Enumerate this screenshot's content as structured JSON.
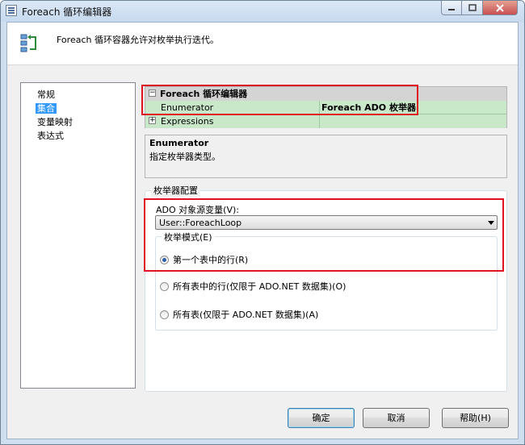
{
  "window": {
    "title": "Foreach 循环编辑器",
    "buttons": [
      "minimize",
      "maximize",
      "close"
    ]
  },
  "header": {
    "description": "Foreach 循环容器允许对枚举执行迭代。",
    "icon": "foreach-container-icon"
  },
  "nav": {
    "items": [
      {
        "label": "常规",
        "selected": false
      },
      {
        "label": "集合",
        "selected": true
      },
      {
        "label": "变量映射",
        "selected": false
      },
      {
        "label": "表达式",
        "selected": false
      }
    ]
  },
  "property_grid": {
    "category": "Foreach 循环编辑器",
    "category_toggle": "⊟",
    "rows": [
      {
        "name": "Enumerator",
        "value": "Foreach ADO 枚举器"
      },
      {
        "name": "Expressions",
        "value": "",
        "toggle": "⊞"
      }
    ]
  },
  "help": {
    "title": "Enumerator",
    "description": "指定枚举器类型。"
  },
  "enumerator_config": {
    "legend": "枚举器配置",
    "source_label": "ADO 对象源变量(V):",
    "source_value": "User::ForeachLoop",
    "mode_legend": "枚举模式(E)",
    "modes": [
      {
        "label": "第一个表中的行(R)",
        "checked": true
      },
      {
        "label": "所有表中的行(仅限于 ADO.NET 数据集)(O)",
        "checked": false
      },
      {
        "label": "所有表(仅限于 ADO.NET 数据集)(A)",
        "checked": false
      }
    ]
  },
  "buttons": {
    "ok": "确定",
    "cancel": "取消",
    "help": "帮助(H)"
  },
  "colors": {
    "highlight_box": "#e0141e",
    "selected_nav": "#3399ff",
    "grid_row": "#c9e7c9"
  }
}
